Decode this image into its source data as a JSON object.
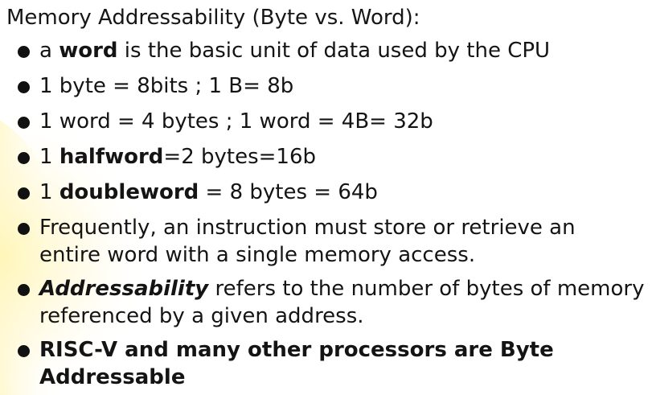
{
  "slide": {
    "title": "Memory Addressability (Byte vs. Word):",
    "bullets": [
      {
        "prefix": "a ",
        "term": "word",
        "suffix": " is the basic unit of data used by the CPU"
      },
      {
        "text": "1 byte = 8bits ; 1 B= 8b"
      },
      {
        "text": "1 word = 4 bytes ; 1 word = 4B= 32b"
      },
      {
        "prefix": "1 ",
        "term": "halfword",
        "suffix": "=2 bytes=16b"
      },
      {
        "prefix": "1 ",
        "term": "doubleword",
        "suffix": " = 8 bytes = 64b"
      },
      {
        "line1": "Frequently, an instruction must store or retrieve an",
        "line2": "entire word with a single memory access."
      },
      {
        "term": "Addressability",
        "line1_rest": " refers to the number of bytes of memory",
        "line2": "referenced by a given address."
      },
      {
        "line1": "RISC-V and many other processors are Byte",
        "line2": "Addressable"
      }
    ]
  }
}
